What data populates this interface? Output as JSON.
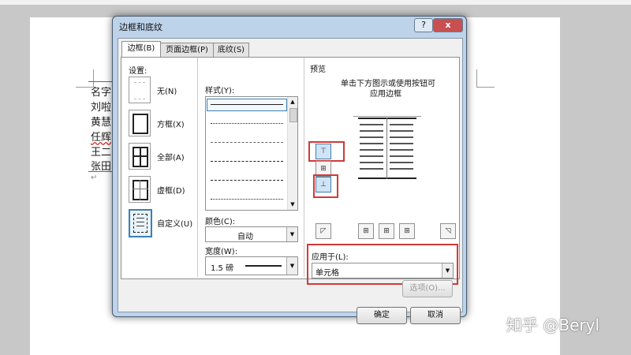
{
  "dialog": {
    "title": "边框和底纹",
    "help": "?",
    "close": "x",
    "tabs": [
      "边框(B)",
      "页面边框(P)",
      "底纹(S)"
    ],
    "setting_label": "设置:",
    "settings": [
      "无(N)",
      "方框(X)",
      "全部(A)",
      "虚框(D)",
      "自定义(U)"
    ],
    "style_label": "样式(Y):",
    "color_label": "颜色(C):",
    "color_value": "自动",
    "width_label": "宽度(W):",
    "width_value": "1.5 磅",
    "preview_label": "预览",
    "preview_hint_1": "单击下方图示或使用按钮可",
    "preview_hint_2": "应用边框",
    "apply_label": "应用于(L):",
    "apply_value": "单元格",
    "options_button": "选项(O)...",
    "ok_button": "确定",
    "cancel_button": "取消"
  },
  "document": {
    "lines": [
      "名字",
      "刘啦",
      "黄慧",
      "任辉",
      "王二",
      "张田"
    ]
  },
  "watermark": "知乎 @Beryl",
  "colors": {
    "accent": "#3c7fb1",
    "highlight": "#d03a3a",
    "titlebar": "#bcd3ea"
  }
}
